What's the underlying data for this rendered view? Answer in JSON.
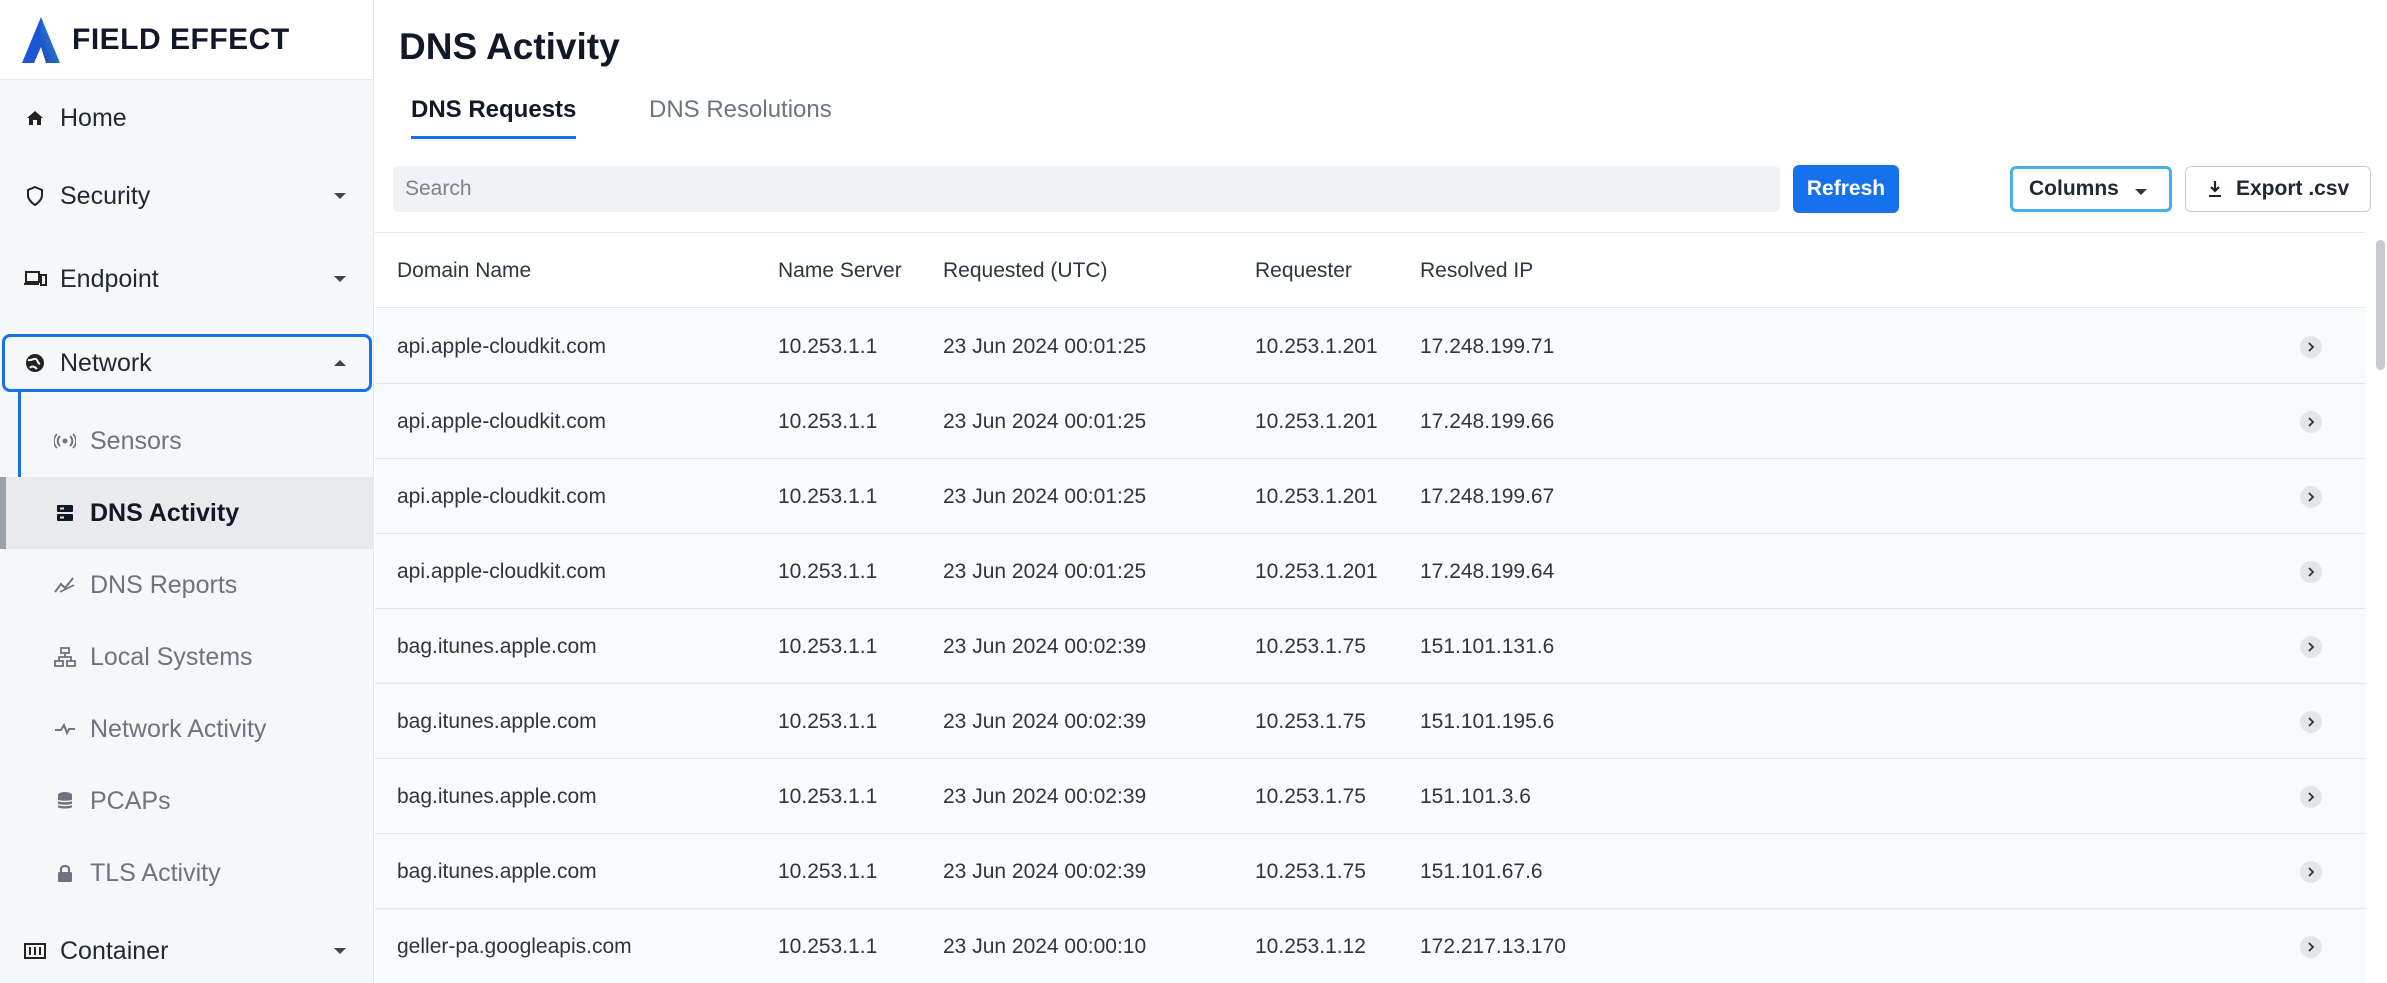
{
  "brand": {
    "name": "FIELD EFFECT"
  },
  "sidebar": {
    "items": [
      {
        "label": "Home",
        "icon": "home-icon"
      },
      {
        "label": "Security",
        "icon": "shield-icon",
        "expandable": true
      },
      {
        "label": "Endpoint",
        "icon": "devices-icon",
        "expandable": true
      },
      {
        "label": "Network",
        "icon": "network-globe-icon",
        "expandable": true,
        "expanded": true
      },
      {
        "label": "Container",
        "icon": "container-icon",
        "expandable": true
      }
    ],
    "network_sub": [
      {
        "label": "Sensors",
        "icon": "sensor-icon"
      },
      {
        "label": "DNS Activity",
        "icon": "dns-server-icon",
        "active": true
      },
      {
        "label": "DNS Reports",
        "icon": "chart-line-icon"
      },
      {
        "label": "Local Systems",
        "icon": "sitemap-icon"
      },
      {
        "label": "Network Activity",
        "icon": "activity-icon"
      },
      {
        "label": "PCAPs",
        "icon": "database-icon"
      },
      {
        "label": "TLS Activity",
        "icon": "lock-icon"
      }
    ]
  },
  "page": {
    "title": "DNS Activity"
  },
  "tabs": [
    {
      "label": "DNS Requests",
      "active": true
    },
    {
      "label": "DNS Resolutions",
      "active": false
    }
  ],
  "toolbar": {
    "search_placeholder": "Search",
    "refresh_label": "Refresh",
    "columns_label": "Columns",
    "export_label": "Export .csv"
  },
  "table": {
    "columns": [
      "Domain Name",
      "Name Server",
      "Requested (UTC)",
      "Requester",
      "Resolved IP"
    ],
    "rows": [
      [
        "api.apple-cloudkit.com",
        "10.253.1.1",
        "23 Jun 2024 00:01:25",
        "10.253.1.201",
        "17.248.199.71"
      ],
      [
        "api.apple-cloudkit.com",
        "10.253.1.1",
        "23 Jun 2024 00:01:25",
        "10.253.1.201",
        "17.248.199.66"
      ],
      [
        "api.apple-cloudkit.com",
        "10.253.1.1",
        "23 Jun 2024 00:01:25",
        "10.253.1.201",
        "17.248.199.67"
      ],
      [
        "api.apple-cloudkit.com",
        "10.253.1.1",
        "23 Jun 2024 00:01:25",
        "10.253.1.201",
        "17.248.199.64"
      ],
      [
        "bag.itunes.apple.com",
        "10.253.1.1",
        "23 Jun 2024 00:02:39",
        "10.253.1.75",
        "151.101.131.6"
      ],
      [
        "bag.itunes.apple.com",
        "10.253.1.1",
        "23 Jun 2024 00:02:39",
        "10.253.1.75",
        "151.101.195.6"
      ],
      [
        "bag.itunes.apple.com",
        "10.253.1.1",
        "23 Jun 2024 00:02:39",
        "10.253.1.75",
        "151.101.3.6"
      ],
      [
        "bag.itunes.apple.com",
        "10.253.1.1",
        "23 Jun 2024 00:02:39",
        "10.253.1.75",
        "151.101.67.6"
      ],
      [
        "geller-pa.googleapis.com",
        "10.253.1.1",
        "23 Jun 2024 00:00:10",
        "10.253.1.12",
        "172.217.13.170"
      ]
    ]
  },
  "colors": {
    "accent": "#1672ec",
    "columns_border": "#45b1e8"
  }
}
